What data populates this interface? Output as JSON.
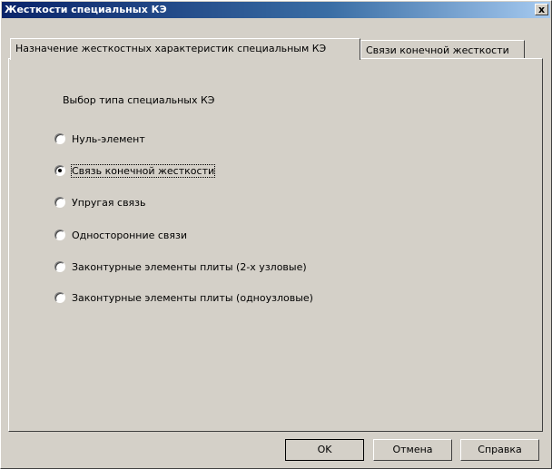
{
  "window": {
    "title": "Жесткости специальных КЭ",
    "close_label": "x"
  },
  "tabs": [
    {
      "label": "Назначение жесткостных характеристик специальным КЭ",
      "active": true
    },
    {
      "label": "Связи конечной жесткости",
      "active": false
    }
  ],
  "group": {
    "label": "Выбор типа специальных КЭ",
    "options": [
      {
        "label": "Нуль-элемент",
        "checked": false
      },
      {
        "label": "Связь конечной жесткости",
        "checked": true
      },
      {
        "label": "Упругая связь",
        "checked": false
      },
      {
        "label": "Односторонние связи",
        "checked": false
      },
      {
        "label": "Законтурные элементы плиты (2-х узловые)",
        "checked": false
      },
      {
        "label": "Законтурные элементы плиты (одноузловые)",
        "checked": false
      }
    ]
  },
  "buttons": {
    "ok": "OK",
    "cancel": "Отмена",
    "help": "Справка"
  }
}
